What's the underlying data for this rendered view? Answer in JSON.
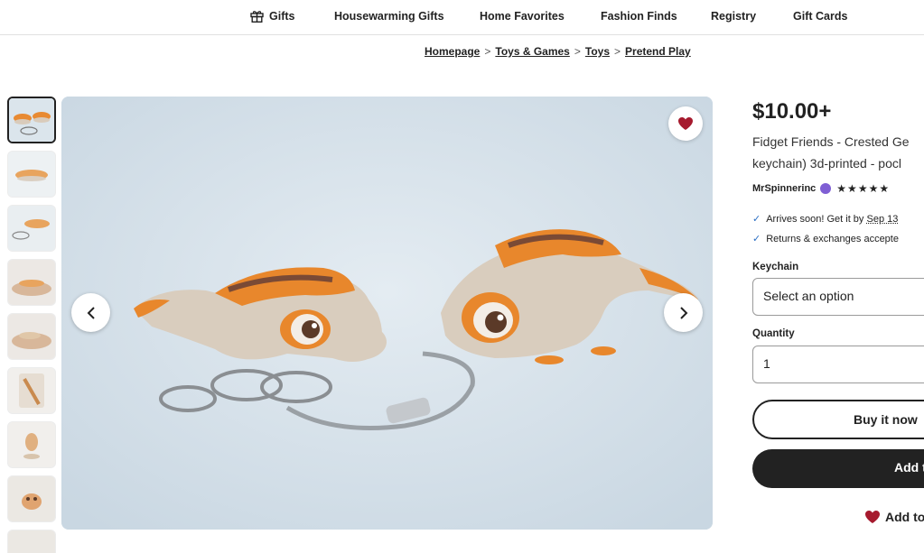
{
  "topnav": {
    "items": [
      {
        "label": "Gifts",
        "icon": "gift-icon"
      },
      {
        "label": "Housewarming Gifts"
      },
      {
        "label": "Home Favorites"
      },
      {
        "label": "Fashion Finds"
      },
      {
        "label": "Registry"
      },
      {
        "label": "Gift Cards"
      }
    ]
  },
  "breadcrumb": [
    "Homepage",
    "Toys & Games",
    "Toys",
    "Pretend Play"
  ],
  "gallery": {
    "favorite_icon": "heart-icon",
    "prev_icon": "chevron-left-icon",
    "next_icon": "chevron-right-icon",
    "selected_thumbnail": 1,
    "thumbnail_count": 8
  },
  "listing": {
    "price": "$10.00+",
    "title_line1": "Fidget Friends - Crested Ge",
    "title_line2": "keychain) 3d-printed - pocl",
    "shop_name": "MrSpinnerinc",
    "stars": "★★★★★",
    "rating": 5,
    "perk1_prefix": "Arrives soon! Get it by ",
    "perk1_date": "Sep 13",
    "perk2": "Returns & exchanges accepte",
    "keychain_label": "Keychain",
    "keychain_value": "Select an option",
    "quantity_label": "Quantity",
    "quantity_value": "1",
    "buy_now": "Buy it now",
    "add_to_cart": "Add t",
    "add_favorites": "Add to"
  },
  "colors": {
    "accent_dark": "#222222",
    "favorite_red": "#a61a2e",
    "check_blue": "#2b6fc4",
    "star_seller_purple": "#7f5fd4"
  }
}
